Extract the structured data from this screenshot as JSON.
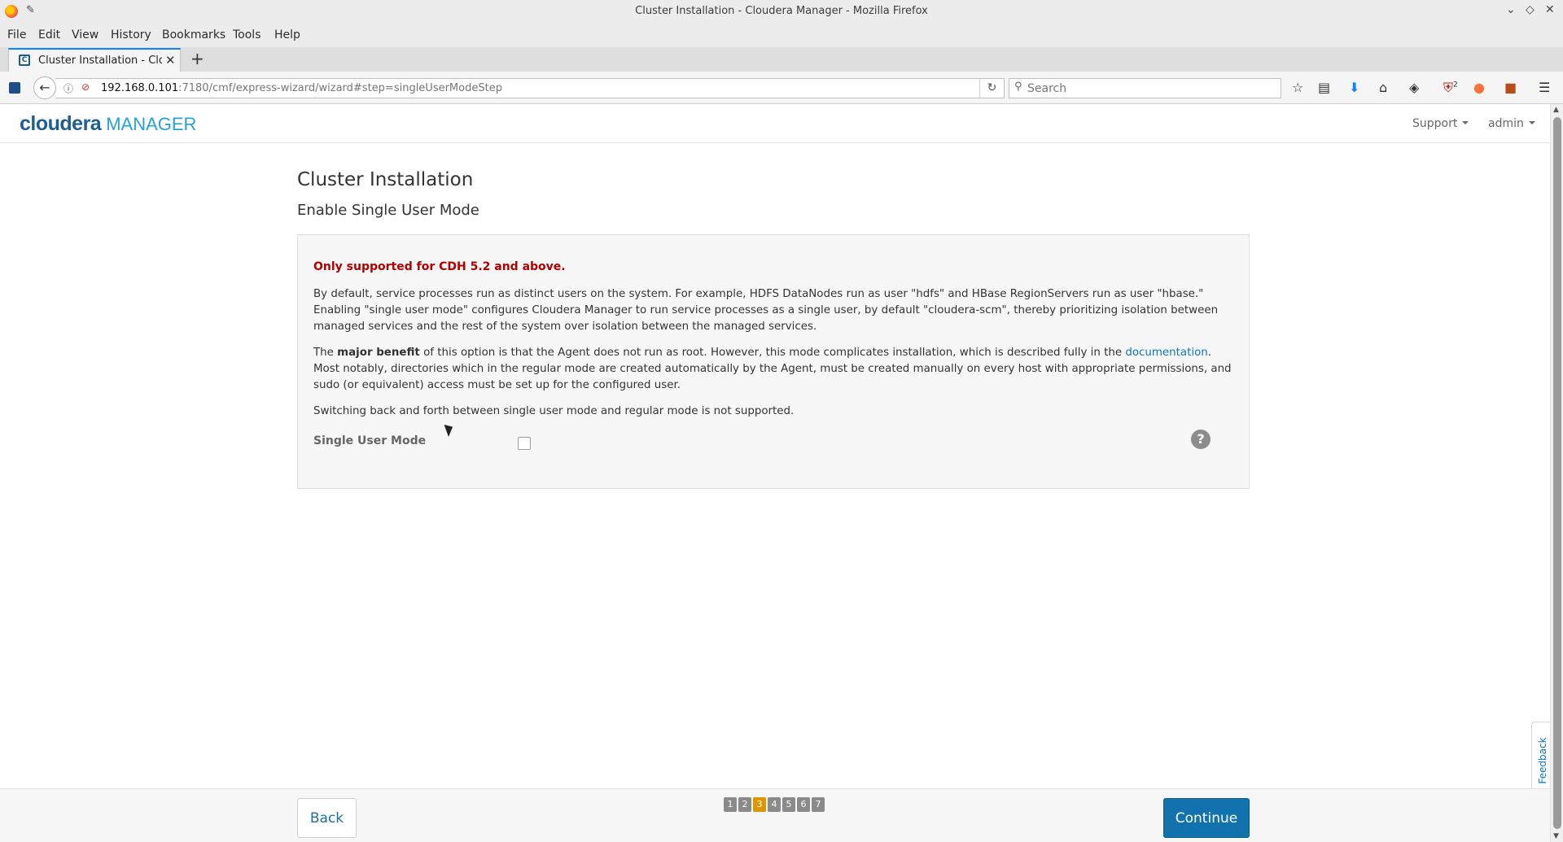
{
  "window": {
    "title": "Cluster Installation - Cloudera Manager - Mozilla Firefox",
    "controls": {
      "minimize": "⌄",
      "maximize": "◇",
      "close": "✕"
    }
  },
  "menu": [
    "File",
    "Edit",
    "View",
    "History",
    "Bookmarks",
    "Tools",
    "Help"
  ],
  "tab": {
    "label": "Cluster Installation - Cloudera Manager",
    "favicon": "C"
  },
  "address": {
    "host": "192.168.0.101",
    "path": ":7180/cmf/express-wizard/wizard#step=singleUserModeStep"
  },
  "search": {
    "placeholder": "Search"
  },
  "toolbar": {
    "ublock_count": "2"
  },
  "header": {
    "logo_main": "cloudera",
    "logo_sub": "MANAGER",
    "support": "Support",
    "user": "admin"
  },
  "main": {
    "title": "Cluster Installation",
    "step_title": "Enable Single User Mode",
    "warning": "Only supported for CDH 5.2 and above.",
    "para1": "By default, service processes run as distinct users on the system. For example, HDFS DataNodes run as user \"hdfs\" and HBase RegionServers run as user \"hbase.\" Enabling \"single user mode\" configures Cloudera Manager to run service processes as a single user, by default \"cloudera-scm\", thereby prioritizing isolation between managed services and the rest of the system over isolation between the managed services.",
    "para2_pre": "The ",
    "para2_bold": "major benefit",
    "para2_mid": " of this option is that the Agent does not run as root. However, this mode complicates installation, which is described fully in the ",
    "para2_link": "documentation",
    "para2_post": ". Most notably, directories which in the regular mode are created automatically by the Agent, must be created manually on every host with appropriate permissions, and sudo (or equivalent) access must be set up for the configured user.",
    "para3": "Switching back and forth between single user mode and regular mode is not supported.",
    "field_label": "Single User Mode",
    "checkbox_checked": false,
    "help": "?"
  },
  "feedback": "Feedback",
  "footer": {
    "back": "Back",
    "continue": "Continue",
    "steps": [
      "1",
      "2",
      "3",
      "4",
      "5",
      "6",
      "7"
    ],
    "current_step": 3
  }
}
